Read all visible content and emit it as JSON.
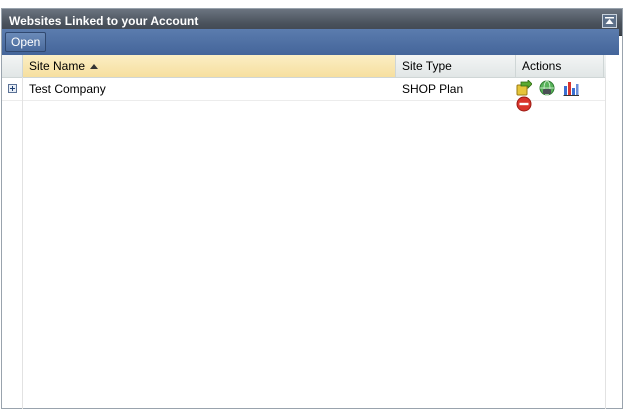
{
  "panel": {
    "title": "Websites Linked to your Account",
    "collapse_icon": "collapse-up-icon"
  },
  "toolbar": {
    "open_label": "Open"
  },
  "grid": {
    "columns": [
      {
        "label": "Site Name",
        "sorted": "ascending"
      },
      {
        "label": "Site Type"
      },
      {
        "label": "Actions"
      }
    ],
    "rows": [
      {
        "expander_icon": "expand-plus-icon",
        "site_name": "Test Company",
        "site_type": "SHOP Plan",
        "actions": [
          "login-arrow-icon",
          "globe-icon",
          "stats-chart-icon",
          "delete-icon"
        ]
      }
    ]
  },
  "colors": {
    "titlebar": "#4a525c",
    "toolbar": "#4f70a3",
    "sorted_header": "#f6df9f",
    "delete": "#d9342b"
  }
}
